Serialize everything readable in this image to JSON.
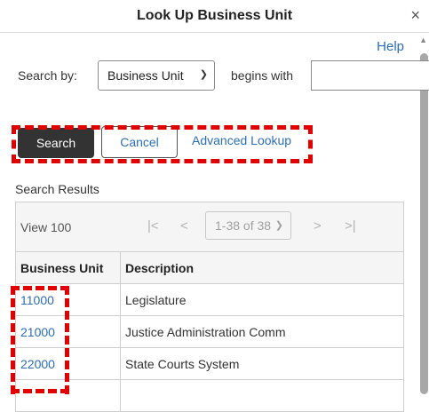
{
  "dialog": {
    "title": "Look Up Business Unit",
    "close_glyph": "×",
    "help_label": "Help"
  },
  "search": {
    "search_by_label": "Search by:",
    "field_value": "Business Unit",
    "operator_label": "begins with",
    "value": "",
    "search_label": "Search",
    "cancel_label": "Cancel",
    "advanced_label": "Advanced Lookup"
  },
  "results": {
    "label": "Search Results",
    "view_label": "View 100",
    "range_label": "1-38 of 38",
    "nav_first": "|<",
    "nav_prev": "<",
    "nav_next": ">",
    "nav_last": ">|",
    "columns": [
      "Business Unit",
      "Description"
    ],
    "rows": [
      {
        "unit": "11000",
        "description": "Legislature"
      },
      {
        "unit": "21000",
        "description": "Justice Administration Comm"
      },
      {
        "unit": "22000",
        "description": "State Courts System"
      },
      {
        "unit": "",
        "description": ""
      }
    ]
  },
  "annotations": {
    "highlight_color": "#e00000"
  },
  "colors": {
    "link": "#2a6ebb",
    "primary_button": "#333333"
  }
}
